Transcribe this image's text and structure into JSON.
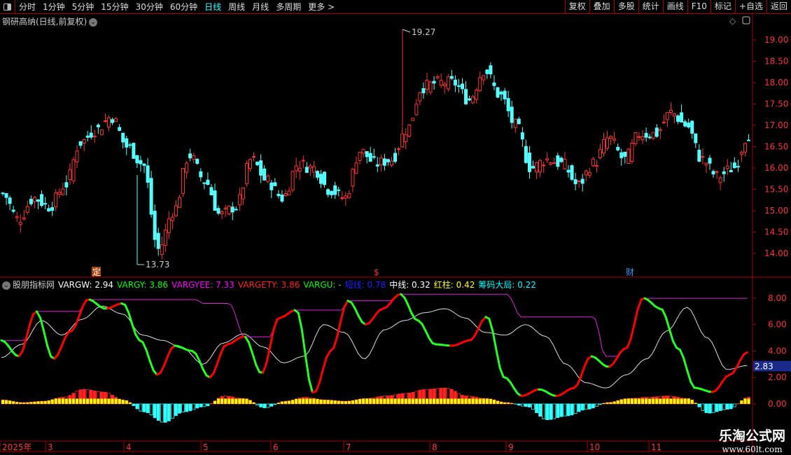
{
  "toolbar": {
    "periods": [
      "分时",
      "1分钟",
      "5分钟",
      "15分钟",
      "30分钟",
      "60分钟",
      "日线",
      "周线",
      "月线",
      "多周期",
      "更多 >"
    ],
    "active": "日线",
    "actions": [
      "复权",
      "叠加",
      "多股",
      "统计",
      "画线",
      "F10",
      "标记",
      "+自选",
      "返回"
    ]
  },
  "stock": {
    "title": "钢研高纳(日线,前复权)",
    "high_label": "19.27",
    "low_label": "13.73",
    "markers": [
      "定",
      "$",
      "财"
    ]
  },
  "price_axis": [
    "19.00",
    "18.50",
    "18.00",
    "17.50",
    "17.00",
    "16.50",
    "16.00",
    "15.50",
    "15.00",
    "14.50",
    "14.00"
  ],
  "indicator": {
    "name": "股朋指标网",
    "items": [
      {
        "label": "VARGW: 2.94",
        "color": "#ffffff"
      },
      {
        "label": "VARGY: 3.86",
        "color": "#00ff00"
      },
      {
        "label": "VARGYEE: 7.33",
        "color": "#ff00ff"
      },
      {
        "label": "VARGETY: 3.86",
        "color": "#ff2020"
      },
      {
        "label": "VARGU: -",
        "color": "#00ff00"
      },
      {
        "label": "短线: 0.78",
        "color": "#2020ff"
      },
      {
        "label": "中线: 0.32",
        "color": "#ffffff"
      },
      {
        "label": "红柱: 0.42",
        "color": "#ffff00"
      },
      {
        "label": "筹码大局: 0.22",
        "color": "#00ffff"
      }
    ],
    "axis": [
      "8.00",
      "6.00",
      "4.00",
      "2.00",
      "0.00"
    ],
    "current": "2.83"
  },
  "time_axis": [
    "2025年",
    "3",
    "4",
    "5",
    "6",
    "7",
    "8",
    "9",
    "10",
    "11"
  ],
  "watermark": {
    "name": "乐淘公式网",
    "url": "www.60lt.com"
  },
  "chart_data": {
    "type": "candlestick",
    "price_keypoints": [
      15.4,
      14.8,
      15.3,
      15.1,
      15.6,
      16.6,
      16.9,
      17.2,
      16.5,
      16.1,
      14.1,
      15.0,
      16.3,
      15.7,
      14.9,
      15.1,
      16.2,
      15.7,
      15.3,
      16.1,
      16.0,
      15.5,
      15.3,
      16.4,
      16.1,
      16.2,
      16.9,
      17.9,
      18.0,
      18.0,
      17.6,
      18.3,
      17.7,
      17.0,
      16.0,
      16.2,
      16.1,
      15.6,
      16.1,
      16.7,
      16.2,
      16.8,
      16.8,
      17.3,
      17.0,
      16.2,
      15.8,
      16.0,
      16.8
    ],
    "indicator_keypoints": [
      4.8,
      3.6,
      7.0,
      3.4,
      5.5,
      7.9,
      7.2,
      7.6,
      4.8,
      2.2,
      4.4,
      4.0,
      2.0,
      4.5,
      5.1,
      2.3,
      6.5,
      7.1,
      0.8,
      4.0,
      7.8,
      6.0,
      7.2,
      8.3,
      6.3,
      4.5,
      4.4,
      4.8,
      6.6,
      2.0,
      0.6,
      1.1,
      0.6,
      1.2,
      3.6,
      2.8,
      4.2,
      8.0,
      7.2,
      4.2,
      1.2,
      0.9,
      2.2,
      3.9
    ],
    "mid_keypoints": [
      3.5,
      4.5,
      6.3,
      5.2,
      6.4,
      7.4,
      6.8,
      5.2,
      4.8,
      4.2,
      3.0,
      4.6,
      5.3,
      4.3,
      3.1,
      3.6,
      6.0,
      5.4,
      3.4,
      5.6,
      6.3,
      6.9,
      7.2,
      6.5,
      5.4,
      5.2,
      6.0,
      5.1,
      3.0,
      1.6,
      1.2,
      2.2,
      3.4,
      5.5,
      7.3,
      5.0,
      2.6,
      2.9
    ]
  }
}
